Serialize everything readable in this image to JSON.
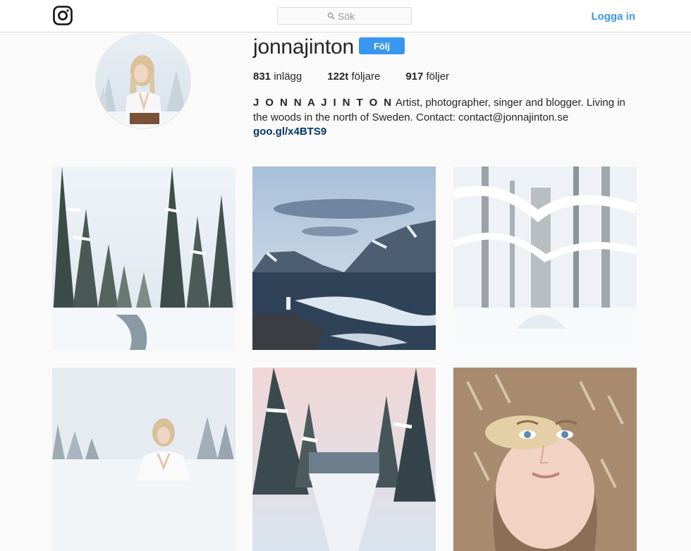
{
  "nav": {
    "logo_icon": "instagram-logo-icon",
    "search_placeholder": "Sök",
    "search_icon": "search-icon",
    "login_label": "Logga in"
  },
  "profile": {
    "username": "jonnajinton",
    "follow_label": "Följ",
    "stats": {
      "posts_count": "831",
      "posts_label": "inlägg",
      "followers_count": "122t",
      "followers_label": "följare",
      "following_count": "917",
      "following_label": "följer"
    },
    "full_name": "J O N N A J I N T O N",
    "bio": "Artist, photographer, singer and blogger. Living in the woods in the north of Sweden. Contact: contact@jonnajinton.se",
    "link": "goo.gl/x4BTS9"
  },
  "colors": {
    "accent": "#3897f0",
    "link": "#003569",
    "border": "#dbdbdb",
    "background": "#fafafa"
  }
}
